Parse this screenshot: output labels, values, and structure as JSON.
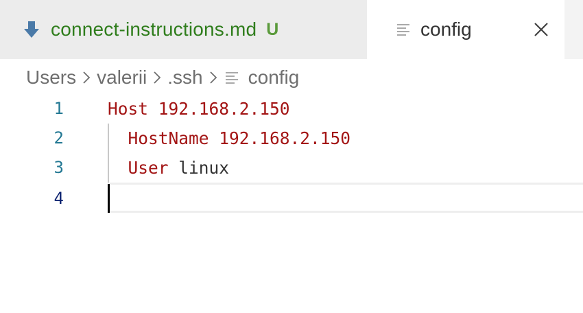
{
  "tabs": [
    {
      "label": "connect-instructions.md",
      "badge": "U",
      "icon": "markdown-download-icon",
      "active": false
    },
    {
      "label": "config",
      "icon": "text-lines-icon",
      "active": true
    }
  ],
  "breadcrumb": {
    "items": [
      "Users",
      "valerii",
      ".ssh"
    ],
    "file_label": "config"
  },
  "editor": {
    "lines": [
      {
        "number": "1",
        "tokens": [
          {
            "text": "Host",
            "kind": "kw"
          },
          {
            "text": " 192.168.2.150",
            "kind": "val"
          }
        ]
      },
      {
        "number": "2",
        "tokens": [
          {
            "text": "  HostName",
            "kind": "kw"
          },
          {
            "text": " 192.168.2.150",
            "kind": "val"
          }
        ]
      },
      {
        "number": "3",
        "tokens": [
          {
            "text": "  User",
            "kind": "kw"
          },
          {
            "text": " linux",
            "kind": "plain"
          }
        ]
      },
      {
        "number": "4",
        "tokens": []
      }
    ],
    "current_line": "4"
  },
  "colors": {
    "modified_label": "#2f7d1c",
    "keyword": "#a31515",
    "line_number": "#237893",
    "line_number_current": "#0b216f"
  }
}
